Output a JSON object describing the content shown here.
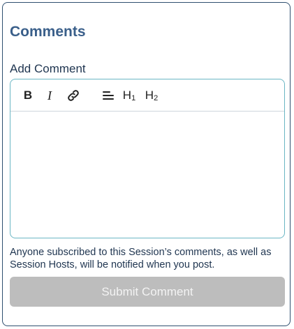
{
  "comments": {
    "title": "Comments",
    "add_comment_label": "Add Comment",
    "toolbar": {
      "bold": "B",
      "italic": "I",
      "link_icon": "link-icon",
      "align_icon": "align-left-icon",
      "h1": "H",
      "h1_sub": "1",
      "h2": "H",
      "h2_sub": "2"
    },
    "editor_value": "",
    "notice": "Anyone subscribed to this Session’s comments, as well as Session Hosts, will be notified when you post.",
    "submit_label": "Submit Comment",
    "colors": {
      "title": "#3a5f8a",
      "editor_border": "#6bb6c4",
      "submit_disabled_bg": "#bdbdbd"
    }
  }
}
